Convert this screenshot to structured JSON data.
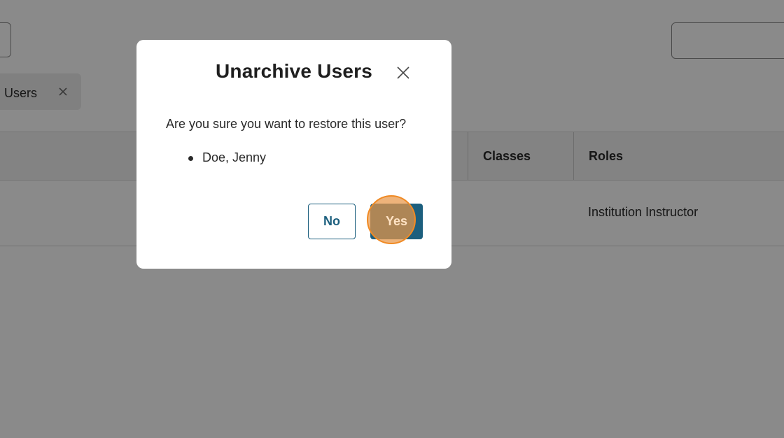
{
  "background": {
    "filter_chip": {
      "label": "Users"
    },
    "table": {
      "columns": [
        "Classes",
        "Roles"
      ],
      "rows": [
        {
          "role": "Institution Instructor"
        }
      ]
    }
  },
  "modal": {
    "title": "Unarchive Users",
    "message": "Are you sure you want to restore this user?",
    "users": [
      "Doe, Jenny"
    ],
    "no_label": "No",
    "yes_label": "Yes"
  },
  "icons": {
    "close": "close-icon",
    "chip_remove": "close-icon"
  },
  "colors": {
    "primary": "#1c5f7e",
    "overlay": "rgba(0,0,0,0.46)",
    "click_highlight": "#f08a24"
  }
}
